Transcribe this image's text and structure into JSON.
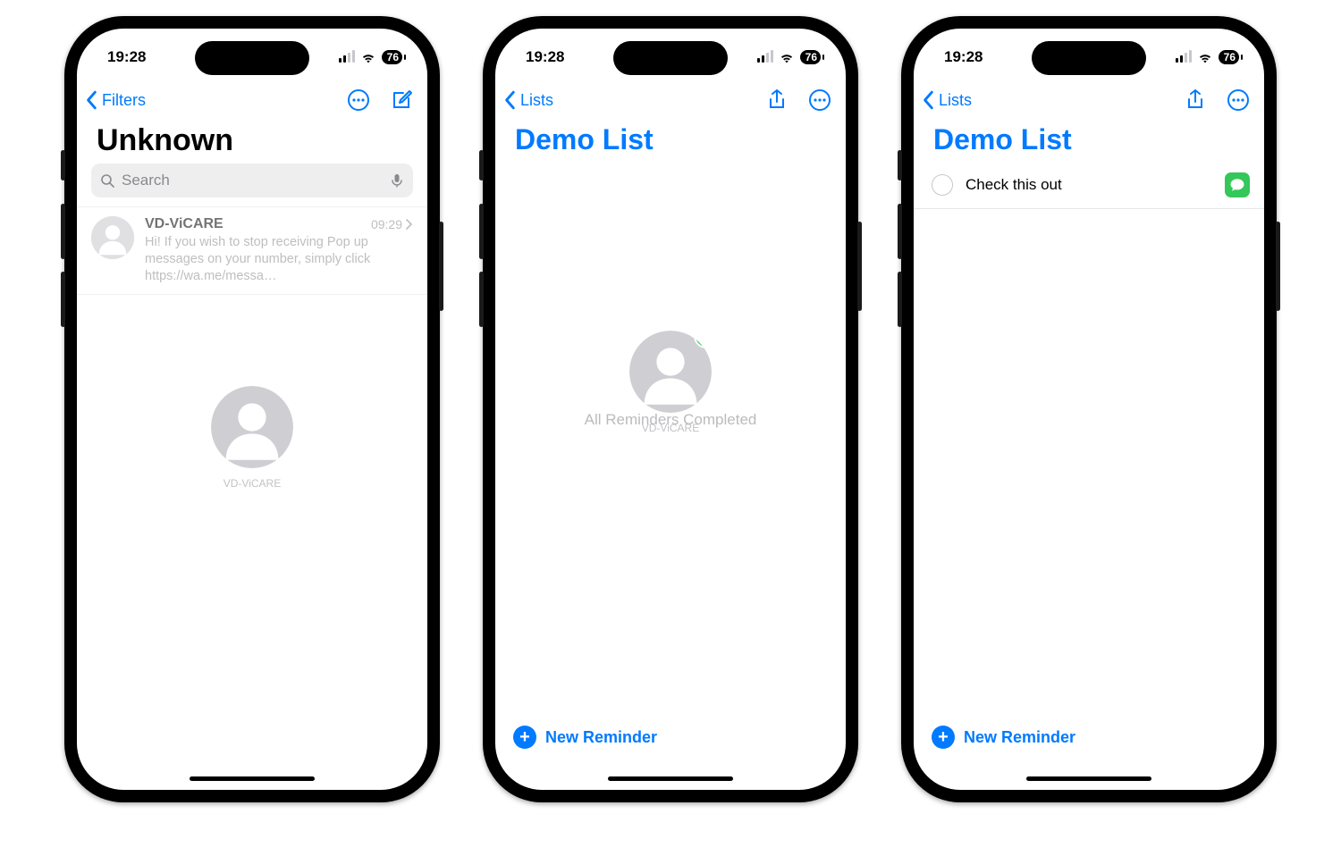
{
  "status": {
    "time": "19:28",
    "battery": "76"
  },
  "phone1": {
    "back_label": "Filters",
    "title": "Unknown",
    "search_placeholder": "Search",
    "message": {
      "sender": "VD-ViCARE",
      "time": "09:29",
      "preview": "Hi! If you wish to stop receiving Pop up messages on your number, simply click https://wa.me/messa…"
    },
    "ghost_caption": "VD-ViCARE"
  },
  "phone2": {
    "back_label": "Lists",
    "title": "Demo List",
    "empty_state": "All Reminders Completed",
    "ghost_caption": "VD-ViCARE",
    "footer_label": "New Reminder"
  },
  "phone3": {
    "back_label": "Lists",
    "title": "Demo List",
    "item_text": "Check this out",
    "footer_label": "New Reminder"
  }
}
